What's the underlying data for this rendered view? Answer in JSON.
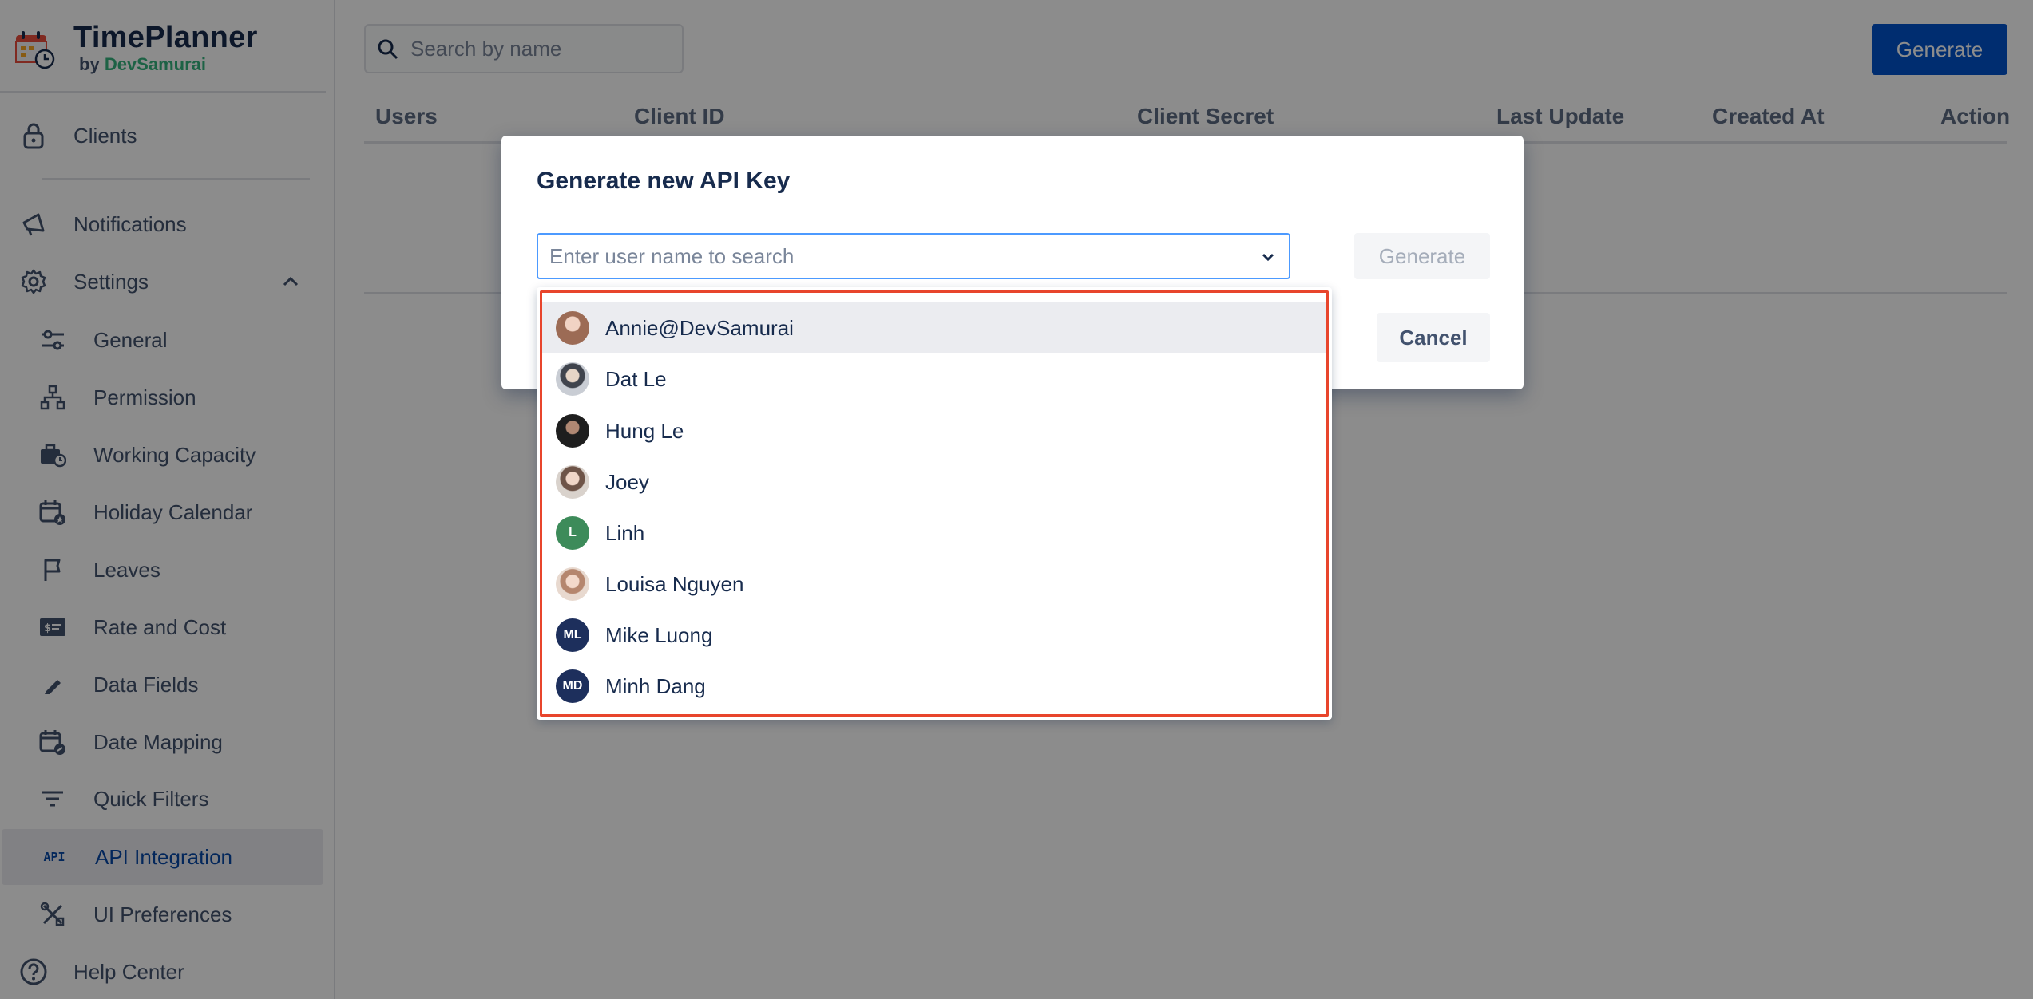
{
  "brand": {
    "title": "TimePlanner",
    "by": "by",
    "maker": "DevSamurai"
  },
  "sidebar": {
    "top_items": [
      {
        "label": "Clients",
        "icon": "lock-icon"
      },
      {
        "label": "Notifications",
        "icon": "megaphone-icon"
      },
      {
        "label": "Settings",
        "icon": "gear-icon"
      }
    ],
    "settings_items": [
      {
        "label": "General",
        "icon": "sliders-icon"
      },
      {
        "label": "Permission",
        "icon": "hierarchy-icon"
      },
      {
        "label": "Working Capacity",
        "icon": "briefcase-clock-icon"
      },
      {
        "label": "Holiday Calendar",
        "icon": "calendar-star-icon"
      },
      {
        "label": "Leaves",
        "icon": "flag-icon"
      },
      {
        "label": "Rate and Cost",
        "icon": "money-card-icon"
      },
      {
        "label": "Data Fields",
        "icon": "pencil-icon"
      },
      {
        "label": "Date Mapping",
        "icon": "calendar-link-icon"
      },
      {
        "label": "Quick Filters",
        "icon": "filter-icon"
      },
      {
        "label": "API Integration",
        "icon": "api-icon",
        "api_text": "API"
      },
      {
        "label": "UI Preferences",
        "icon": "tools-icon"
      }
    ],
    "help": {
      "label": "Help Center",
      "icon": "question-circle-icon"
    }
  },
  "main": {
    "search": {
      "placeholder": "Search by name"
    },
    "generate_label": "Generate",
    "columns": [
      "Users",
      "Client ID",
      "Client Secret",
      "Last Update",
      "Created At",
      "Action"
    ]
  },
  "modal": {
    "title": "Generate new API Key",
    "select_placeholder": "Enter user name to search",
    "generate_label": "Generate",
    "cancel_label": "Cancel",
    "options": [
      {
        "name": "Annie@DevSamurai",
        "avatar": "photo",
        "color": "#C89B86"
      },
      {
        "name": "Dat Le",
        "avatar": "photo",
        "color": "#8A8F98"
      },
      {
        "name": "Hung Le",
        "avatar": "photo",
        "color": "#3A3A3A"
      },
      {
        "name": "Joey",
        "avatar": "photo",
        "color": "#B89A8A"
      },
      {
        "name": "Linh",
        "avatar": "L",
        "color": "#3D8B5A"
      },
      {
        "name": "Louisa Nguyen",
        "avatar": "photo",
        "color": "#C7A08E"
      },
      {
        "name": "Mike Luong",
        "avatar": "ML",
        "color": "#1D2F5C"
      },
      {
        "name": "Minh Dang",
        "avatar": "MD",
        "color": "#1D2F5C"
      }
    ]
  },
  "colors": {
    "primary": "#0052CC",
    "active_nav_text": "#0747A6",
    "highlight_border": "#E8452C",
    "focus_border": "#4C9AFF"
  }
}
